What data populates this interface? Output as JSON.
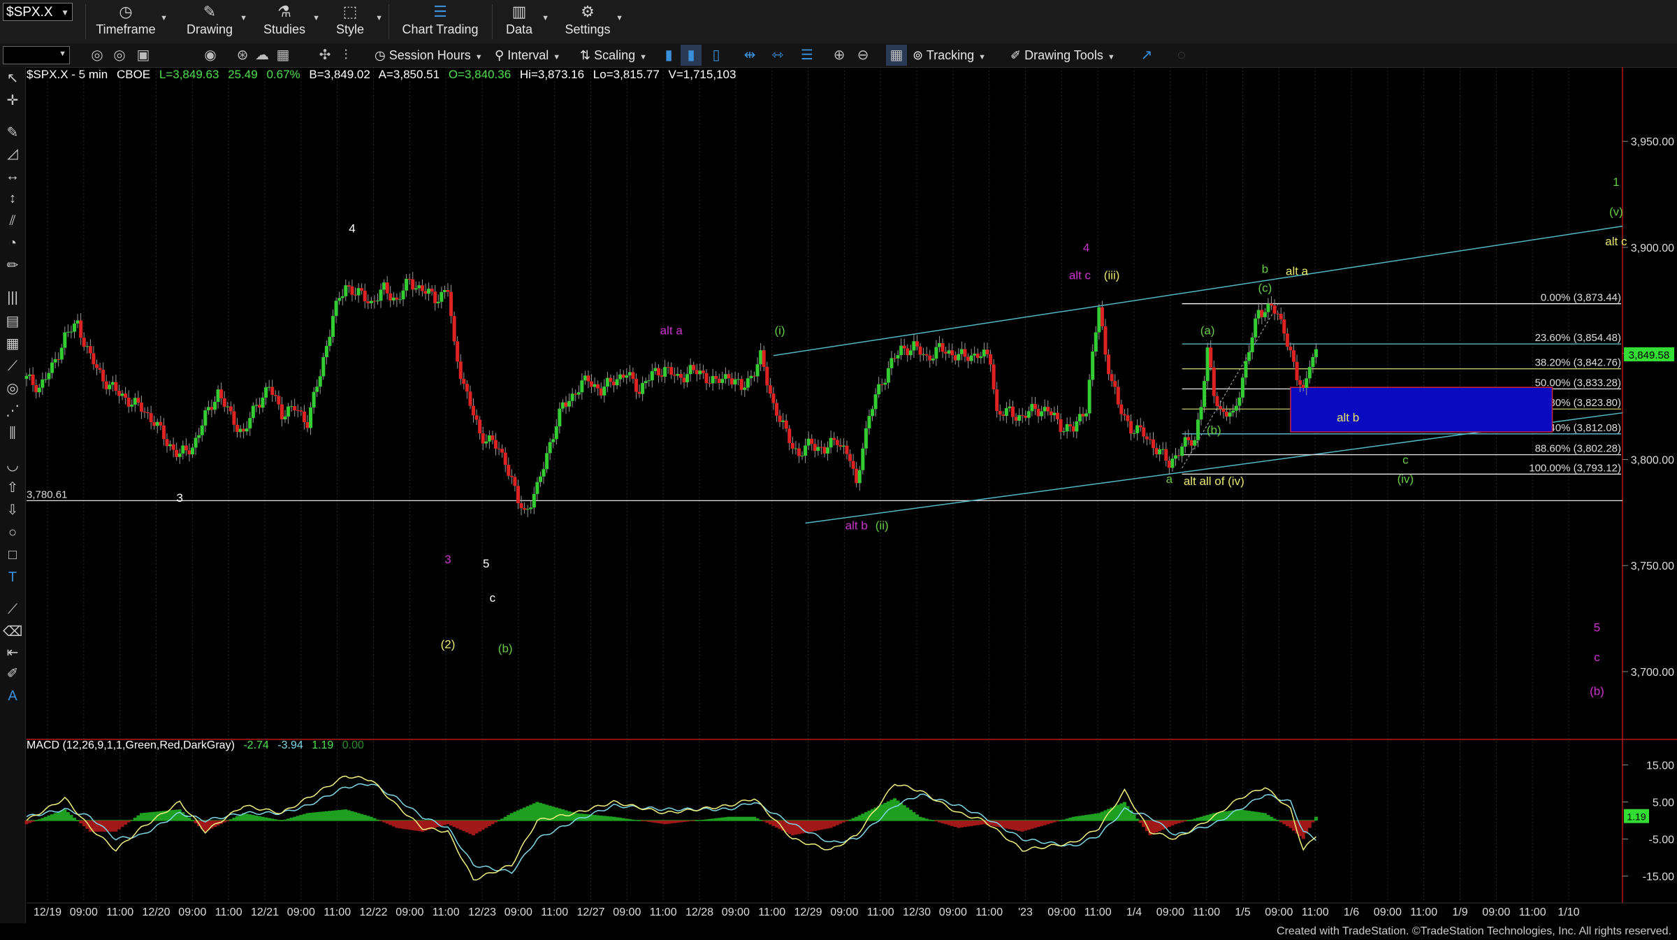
{
  "toolbar": {
    "symbol": "$SPX.X",
    "buttons": [
      {
        "label": "Timeframe",
        "icon": "clock-icon"
      },
      {
        "label": "Drawing",
        "icon": "pencil-icon"
      },
      {
        "label": "Studies",
        "icon": "flask-icon"
      },
      {
        "label": "Style",
        "icon": "style-icon"
      },
      {
        "label": "Chart Trading",
        "icon": "chart-trading-icon"
      },
      {
        "label": "Data",
        "icon": "data-icon"
      },
      {
        "label": "Settings",
        "icon": "gear-icon"
      }
    ],
    "row2": {
      "session_hours": "Session Hours",
      "interval": "Interval",
      "scaling": "Scaling",
      "tracking": "Tracking",
      "drawing_tools": "Drawing Tools"
    }
  },
  "header": {
    "symbol_line": "$SPX.X - 5 min",
    "exchange": "CBOE",
    "last": "L=3,849.63",
    "change": "25.49",
    "pct": "0.67%",
    "bid": "B=3,849.02",
    "ask": "A=3,850.51",
    "open": "O=3,840.36",
    "high": "Hi=3,873.16",
    "low": "Lo=3,815.77",
    "volume": "V=1,715,103"
  },
  "macd_header": {
    "label": "MACD (12,26,9,1,1,Green,Red,DarkGray)",
    "v1": "-2.74",
    "v2": "-3.94",
    "v3": "1.19",
    "v4": "0.00"
  },
  "footer": "Created with TradeStation. ©TradeStation Technologies, Inc. All rights reserved.",
  "chart_data": {
    "type": "candlestick",
    "title": "$SPX.X - 5 min",
    "ylim": [
      3670,
      3985
    ],
    "yticks": [
      "3,950.00",
      "3,900.00",
      "3,850.00",
      "3,800.00",
      "3,750.00",
      "3,700.00"
    ],
    "ytick_values": [
      3950,
      3900,
      3850,
      3800,
      3750,
      3700
    ],
    "current_price": "3,849.58",
    "current_price_value": 3849.58,
    "level_line": {
      "label": "3,780.61",
      "value": 3780.61
    },
    "xticks": [
      "12/19",
      "09:00",
      "11:00",
      "12/20",
      "09:00",
      "11:00",
      "12/21",
      "09:00",
      "11:00",
      "12/22",
      "09:00",
      "11:00",
      "12/23",
      "09:00",
      "11:00",
      "12/27",
      "09:00",
      "11:00",
      "12/28",
      "09:00",
      "11:00",
      "12/29",
      "09:00",
      "11:00",
      "12/30",
      "09:00",
      "11:00",
      "'23",
      "09:00",
      "11:00",
      "1/4",
      "09:00",
      "11:00",
      "1/5",
      "09:00",
      "11:00",
      "1/6",
      "09:00",
      "11:00",
      "1/9",
      "09:00",
      "11:00",
      "1/10"
    ],
    "price_path": [
      [
        0,
        3838
      ],
      [
        2,
        3834
      ],
      [
        4,
        3843
      ],
      [
        6,
        3858
      ],
      [
        8,
        3864
      ],
      [
        10,
        3848
      ],
      [
        12,
        3838
      ],
      [
        14,
        3832
      ],
      [
        16,
        3828
      ],
      [
        18,
        3824
      ],
      [
        20,
        3818
      ],
      [
        22,
        3808
      ],
      [
        24,
        3802
      ],
      [
        26,
        3806
      ],
      [
        28,
        3820
      ],
      [
        30,
        3832
      ],
      [
        32,
        3820
      ],
      [
        34,
        3812
      ],
      [
        36,
        3826
      ],
      [
        38,
        3834
      ],
      [
        40,
        3822
      ],
      [
        42,
        3824
      ],
      [
        44,
        3818
      ],
      [
        46,
        3840
      ],
      [
        48,
        3868
      ],
      [
        50,
        3882
      ],
      [
        52,
        3878
      ],
      [
        54,
        3874
      ],
      [
        56,
        3880
      ],
      [
        58,
        3875
      ],
      [
        60,
        3884
      ],
      [
        62,
        3880
      ],
      [
        64,
        3876
      ],
      [
        66,
        3880
      ],
      [
        67,
        3853
      ],
      [
        69,
        3830
      ],
      [
        71,
        3812
      ],
      [
        73,
        3808
      ],
      [
        75,
        3800
      ],
      [
        77,
        3780
      ],
      [
        78,
        3775
      ],
      [
        80,
        3786
      ],
      [
        82,
        3808
      ],
      [
        84,
        3825
      ],
      [
        86,
        3832
      ],
      [
        88,
        3838
      ],
      [
        90,
        3832
      ],
      [
        92,
        3838
      ],
      [
        94,
        3840
      ],
      [
        96,
        3833
      ],
      [
        98,
        3840
      ],
      [
        100,
        3843
      ],
      [
        102,
        3838
      ],
      [
        104,
        3842
      ],
      [
        106,
        3840
      ],
      [
        108,
        3836
      ],
      [
        110,
        3840
      ],
      [
        112,
        3833
      ],
      [
        114,
        3842
      ],
      [
        115,
        3848
      ],
      [
        117,
        3826
      ],
      [
        119,
        3812
      ],
      [
        121,
        3802
      ],
      [
        123,
        3808
      ],
      [
        125,
        3804
      ],
      [
        127,
        3810
      ],
      [
        129,
        3800
      ],
      [
        130,
        3787
      ],
      [
        131,
        3808
      ],
      [
        133,
        3830
      ],
      [
        135,
        3843
      ],
      [
        137,
        3852
      ],
      [
        139,
        3853
      ],
      [
        141,
        3848
      ],
      [
        143,
        3852
      ],
      [
        145,
        3850
      ],
      [
        147,
        3848
      ],
      [
        149,
        3850
      ],
      [
        151,
        3847
      ],
      [
        152,
        3822
      ],
      [
        154,
        3822
      ],
      [
        156,
        3820
      ],
      [
        158,
        3824
      ],
      [
        160,
        3823
      ],
      [
        162,
        3816
      ],
      [
        164,
        3814
      ],
      [
        166,
        3825
      ],
      [
        168,
        3872
      ],
      [
        169,
        3850
      ],
      [
        171,
        3825
      ],
      [
        173,
        3815
      ],
      [
        175,
        3812
      ],
      [
        177,
        3805
      ],
      [
        179,
        3798
      ],
      [
        181,
        3806
      ],
      [
        183,
        3810
      ],
      [
        184,
        3826
      ],
      [
        185,
        3850
      ],
      [
        186,
        3832
      ],
      [
        187,
        3823
      ],
      [
        189,
        3820
      ],
      [
        191,
        3845
      ],
      [
        193,
        3870
      ],
      [
        195,
        3872
      ],
      [
        197,
        3862
      ],
      [
        199,
        3838
      ],
      [
        200,
        3832
      ],
      [
        201,
        3847
      ],
      [
        202,
        3849
      ]
    ],
    "labels": [
      {
        "text": "4",
        "color": "#ffffff",
        "x": 51,
        "y": 3907
      },
      {
        "text": "3",
        "color": "#ffffff",
        "x": 24,
        "y": 3780
      },
      {
        "text": "5",
        "color": "#ffffff",
        "x": 72,
        "y": 3749
      },
      {
        "text": "c",
        "color": "#ffffff",
        "x": 73,
        "y": 3733
      },
      {
        "text": "3",
        "color": "#cc33cc",
        "x": 66,
        "y": 3751
      },
      {
        "text": "(2)",
        "color": "#e8e870",
        "x": 66,
        "y": 3711
      },
      {
        "text": "(b)",
        "color": "#66cc44",
        "x": 75,
        "y": 3709
      },
      {
        "text": "alt a",
        "color": "#cc33cc",
        "x": 101,
        "y": 3859
      },
      {
        "text": "(i)",
        "color": "#66cc44",
        "x": 118,
        "y": 3859
      },
      {
        "text": "alt b",
        "color": "#cc33cc",
        "x": 130,
        "y": 3767
      },
      {
        "text": "(ii)",
        "color": "#66cc44",
        "x": 134,
        "y": 3767
      },
      {
        "text": "4",
        "color": "#cc33cc",
        "x": 166,
        "y": 3898
      },
      {
        "text": "alt c",
        "color": "#cc33cc",
        "x": 165,
        "y": 3885
      },
      {
        "text": "(iii)",
        "color": "#e8e870",
        "x": 170,
        "y": 3885
      },
      {
        "text": "(a)",
        "color": "#66cc44",
        "x": 185,
        "y": 3859
      },
      {
        "text": "b",
        "color": "#66cc44",
        "x": 194,
        "y": 3888
      },
      {
        "text": "alt a",
        "color": "#e8e870",
        "x": 199,
        "y": 3887
      },
      {
        "text": "(c)",
        "color": "#66cc44",
        "x": 194,
        "y": 3879
      },
      {
        "text": "(b)",
        "color": "#66cc44",
        "x": 186,
        "y": 3812
      },
      {
        "text": "alt b",
        "color": "#e8e870",
        "x": 207,
        "y": 3818
      },
      {
        "text": "a",
        "color": "#66cc44",
        "x": 179,
        "y": 3789
      },
      {
        "text": "alt all of (iv)",
        "color": "#e8e870",
        "x": 186,
        "y": 3788
      },
      {
        "text": "c",
        "color": "#66cc44",
        "x": 216,
        "y": 3798
      },
      {
        "text": "(iv)",
        "color": "#66cc44",
        "x": 216,
        "y": 3789
      },
      {
        "text": "1",
        "color": "#66cc44",
        "x": 249,
        "y": 3929
      },
      {
        "text": "(v)",
        "color": "#66cc44",
        "x": 249,
        "y": 3915
      },
      {
        "text": "alt c",
        "color": "#e8e870",
        "x": 249,
        "y": 3901
      },
      {
        "text": "5",
        "color": "#cc33cc",
        "x": 246,
        "y": 3719
      },
      {
        "text": "c",
        "color": "#cc33cc",
        "x": 246,
        "y": 3705
      },
      {
        "text": "(b)",
        "color": "#cc33cc",
        "x": 246,
        "y": 3689
      }
    ],
    "fibonacci": [
      {
        "label": "0.00% (3,873.44)",
        "value": 3873.44,
        "color": "#ffffff"
      },
      {
        "label": "23.60% (3,854.48)",
        "value": 3854.48,
        "color": "#5fc4d4"
      },
      {
        "label": "38.20% (3,842.76)",
        "value": 3842.76,
        "color": "#c8c870"
      },
      {
        "label": "50.00% (3,833.28)",
        "value": 3833.28,
        "color": "#dddddd"
      },
      {
        "label": "61.80% (3,823.80)",
        "value": 3823.8,
        "color": "#c8c870"
      },
      {
        "label": "76.40% (3,812.08)",
        "value": 3812.08,
        "color": "#5fc4d4"
      },
      {
        "label": "88.60% (3,802.28)",
        "value": 3802.28,
        "color": "#dddddd"
      },
      {
        "label": "100.00% (3,793.12)",
        "value": 3793.12,
        "color": "#ffffff"
      }
    ],
    "macd": {
      "ylim": [
        -20,
        20
      ],
      "yticks": [
        "15.00",
        "5.00",
        "-5.00",
        "-15.00"
      ],
      "ytick_values": [
        15,
        5,
        -5,
        -15
      ],
      "current": "1.19",
      "current_value": 1.19,
      "macd_path": [
        [
          0,
          0
        ],
        [
          6,
          6
        ],
        [
          10,
          -2
        ],
        [
          14,
          -8
        ],
        [
          18,
          -2
        ],
        [
          24,
          5
        ],
        [
          28,
          -3
        ],
        [
          34,
          4
        ],
        [
          40,
          2
        ],
        [
          44,
          6
        ],
        [
          50,
          12
        ],
        [
          54,
          11
        ],
        [
          58,
          4
        ],
        [
          62,
          -2
        ],
        [
          66,
          -3
        ],
        [
          70,
          -16
        ],
        [
          76,
          -12
        ],
        [
          80,
          0
        ],
        [
          86,
          2
        ],
        [
          92,
          5
        ],
        [
          100,
          2
        ],
        [
          110,
          4
        ],
        [
          114,
          6
        ],
        [
          120,
          -5
        ],
        [
          126,
          -8
        ],
        [
          130,
          -4
        ],
        [
          136,
          10
        ],
        [
          140,
          8
        ],
        [
          146,
          2
        ],
        [
          150,
          0
        ],
        [
          156,
          -8
        ],
        [
          164,
          -6
        ],
        [
          168,
          -2
        ],
        [
          172,
          8
        ],
        [
          176,
          -3
        ],
        [
          180,
          -5
        ],
        [
          186,
          1
        ],
        [
          190,
          6
        ],
        [
          194,
          9
        ],
        [
          198,
          3
        ],
        [
          200,
          -8
        ],
        [
          202,
          -4
        ]
      ],
      "signal_path": [
        [
          0,
          1
        ],
        [
          6,
          3
        ],
        [
          10,
          1
        ],
        [
          14,
          -5
        ],
        [
          18,
          -4
        ],
        [
          24,
          2
        ],
        [
          28,
          0
        ],
        [
          34,
          2
        ],
        [
          40,
          2
        ],
        [
          44,
          4
        ],
        [
          50,
          9
        ],
        [
          54,
          10
        ],
        [
          58,
          6
        ],
        [
          62,
          1
        ],
        [
          66,
          -2
        ],
        [
          70,
          -12
        ],
        [
          76,
          -14
        ],
        [
          80,
          -5
        ],
        [
          86,
          0
        ],
        [
          92,
          4
        ],
        [
          100,
          3
        ],
        [
          110,
          3
        ],
        [
          114,
          5
        ],
        [
          120,
          -1
        ],
        [
          126,
          -6
        ],
        [
          130,
          -5
        ],
        [
          136,
          4
        ],
        [
          140,
          7
        ],
        [
          146,
          4
        ],
        [
          150,
          1
        ],
        [
          156,
          -5
        ],
        [
          164,
          -7
        ],
        [
          168,
          -4
        ],
        [
          172,
          3
        ],
        [
          176,
          1
        ],
        [
          180,
          -4
        ],
        [
          186,
          -1
        ],
        [
          190,
          3
        ],
        [
          194,
          7
        ],
        [
          198,
          5
        ],
        [
          200,
          -3
        ],
        [
          202,
          -5
        ]
      ]
    }
  }
}
